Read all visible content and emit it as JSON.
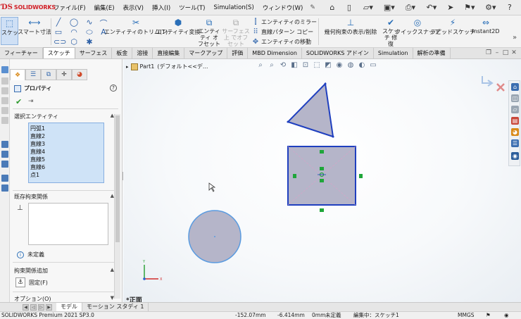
{
  "app": {
    "brand": "SOLIDWORKS",
    "menu": [
      "ファイル(F)",
      "編集(E)",
      "表示(V)",
      "挿入(I)",
      "ツール(T)",
      "Simulation(S)",
      "ウィンドウ(W)"
    ]
  },
  "command_manager": {
    "sketch_label": "スケッチ",
    "smart_dim_label": "スマート寸法",
    "trim_label": "エンティティのトリム(T)",
    "convert_label": "エンティティ変換",
    "offset_label": "エンティティ オフセット",
    "surface_offset_label": "サーフェス上 でオフセット",
    "mirror_label": "エンティティのミラー",
    "linear_pattern_label": "直線パターン コピー",
    "move_label": "エンティティの移動",
    "relations_label": "幾何拘束の表示/削除",
    "repair_label": "スケッチ 修復",
    "quick_snaps_label": "クイックスナップ",
    "rapid_sketch_label": "ラピッドスケッチ",
    "instant2d_label": "Instant2D"
  },
  "tabs": [
    {
      "label": "フィーチャー",
      "active": false
    },
    {
      "label": "スケッチ",
      "active": true
    },
    {
      "label": "サーフェス",
      "active": false
    },
    {
      "label": "板金",
      "active": false
    },
    {
      "label": "溶接",
      "active": false
    },
    {
      "label": "直接編集",
      "active": false
    },
    {
      "label": "マークアップ",
      "active": false
    },
    {
      "label": "評価",
      "active": false
    },
    {
      "label": "MBD Dimension",
      "active": false
    },
    {
      "label": "SOLIDWORKS アドイン",
      "active": false
    },
    {
      "label": "Simulation",
      "active": false
    },
    {
      "label": "解析の準備",
      "active": false
    }
  ],
  "property_manager": {
    "title": "プロパティ",
    "help": "?",
    "selected_entities_header": "選択エンティティ",
    "selected_entities": [
      "円弧1",
      "直線2",
      "直線3",
      "直線4",
      "直線5",
      "直線6",
      "点1"
    ],
    "existing_relations_header": "既存拘束関係",
    "status": "未定義",
    "add_relations_header": "拘束関係追加",
    "fix_label": "固定(F)",
    "options_header": "オプション(O)"
  },
  "graphics": {
    "tree_item": "Part1",
    "tree_config": "(デフォルト<<デ...",
    "view_label": "*正面"
  },
  "bottom_tabs": [
    {
      "label": "モデル",
      "active": true
    },
    {
      "label": "モーション スタディ 1",
      "active": false
    }
  ],
  "status_bar": {
    "product": "SOLIDWORKS Premium 2021 SP3.0",
    "x": "-152.07mm",
    "y": "-6.414mm",
    "z": "0mm",
    "definition": "未定義",
    "editing": "編集中：スケッチ1",
    "units": "MMGS"
  },
  "colors": {
    "selection_blue": "#1f3fbf",
    "sketch_fill": "#b5b5c9",
    "handle_green": "#1fa63a",
    "circle_stroke": "#5a9be0"
  }
}
